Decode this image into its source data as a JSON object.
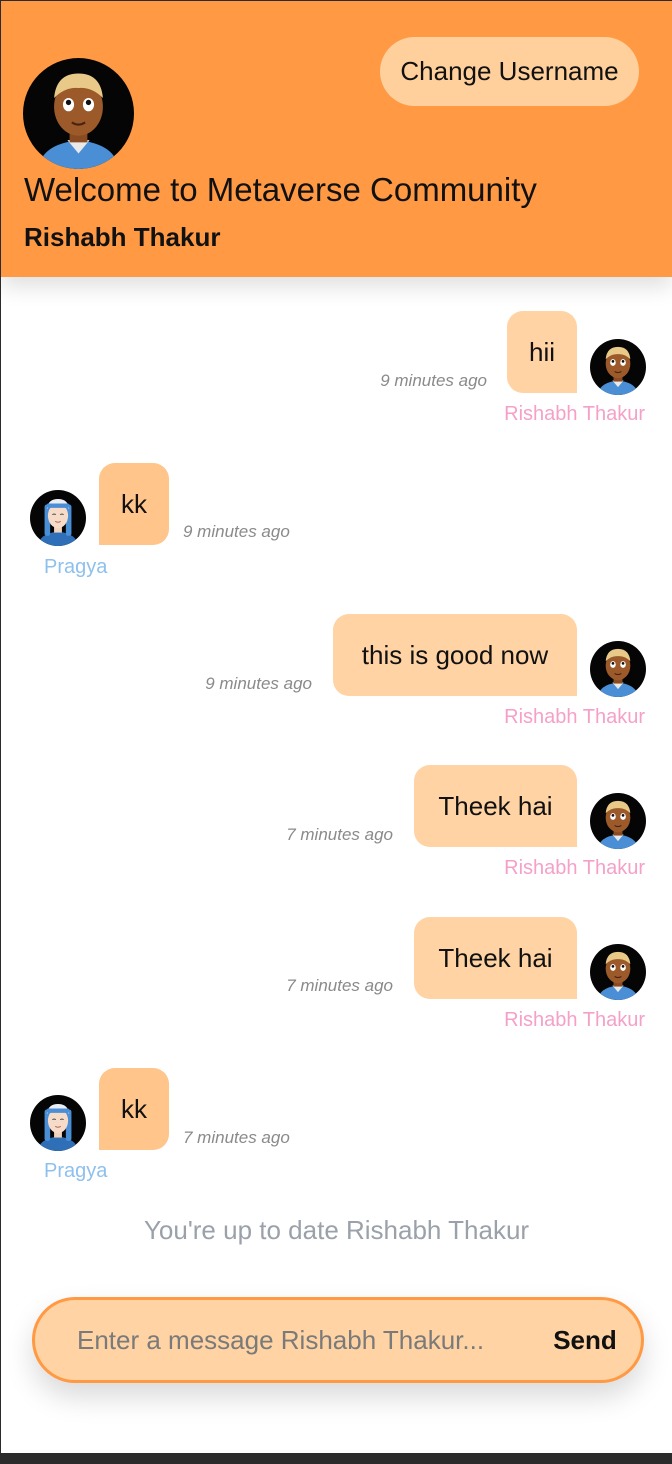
{
  "header": {
    "change_username_label": "Change Username",
    "welcome_text": "Welcome to Metaverse Community",
    "username": "Rishabh Thakur",
    "background_color": "#ff9944"
  },
  "messages": [
    {
      "text": "hii",
      "time": "9 minutes ago",
      "sender": "Rishabh Thakur",
      "side": "right",
      "avatar": "man-avatar-icon"
    },
    {
      "text": "kk",
      "time": "9 minutes ago",
      "sender": "Pragya",
      "side": "left",
      "avatar": "woman-avatar-icon"
    },
    {
      "text": "this is good now",
      "time": "9 minutes ago",
      "sender": "Rishabh Thakur",
      "side": "right",
      "avatar": "man-avatar-icon"
    },
    {
      "text": "Theek hai",
      "time": "7 minutes ago",
      "sender": "Rishabh Thakur",
      "side": "right",
      "avatar": "man-avatar-icon"
    },
    {
      "text": "Theek hai",
      "time": "7 minutes ago",
      "sender": "Rishabh Thakur",
      "side": "right",
      "avatar": "man-avatar-icon"
    },
    {
      "text": "kk",
      "time": "7 minutes ago",
      "sender": "Pragya",
      "side": "left",
      "avatar": "woman-avatar-icon"
    }
  ],
  "status_text": "You're up to date Rishabh Thakur",
  "composer": {
    "placeholder": "Enter a message Rishabh Thakur...",
    "value": "",
    "send_label": "Send"
  },
  "colors": {
    "bubble_right": "#ffd3a3",
    "bubble_left": "#ffc58a",
    "sender_self": "#f5a0c8",
    "sender_other": "#8ec0ee"
  }
}
